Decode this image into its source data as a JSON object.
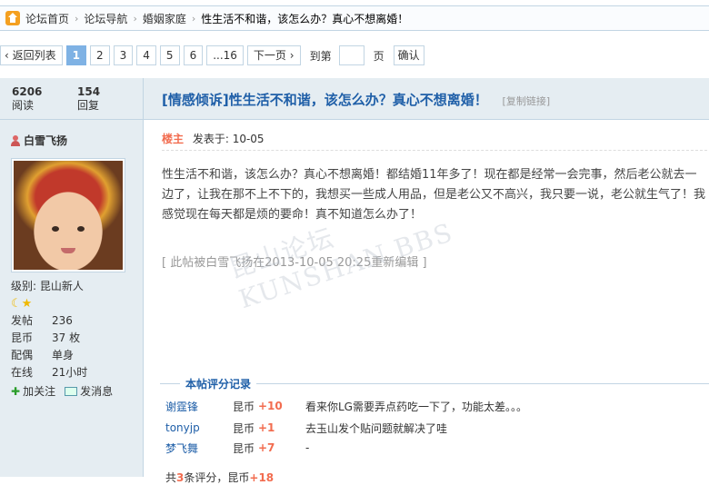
{
  "breadcrumb": {
    "items": [
      "论坛首页",
      "论坛导航",
      "婚姻家庭",
      "性生活不和谐，该怎么办？真心不想离婚！"
    ]
  },
  "pager": {
    "back_label": "返回列表",
    "pages": [
      "1",
      "2",
      "3",
      "4",
      "5",
      "6",
      "...16"
    ],
    "next_label": "下一页",
    "jump_label": "到第",
    "page_unit": "页",
    "confirm_label": "确认"
  },
  "stats": {
    "views": "6206",
    "views_label": "阅读",
    "replies": "154",
    "replies_label": "回复"
  },
  "author": {
    "name": "白雪飞扬",
    "level_label": "级别: 昆山新人",
    "profile": [
      {
        "k": "发帖",
        "v": "236"
      },
      {
        "k": "昆币",
        "v": "37 枚"
      },
      {
        "k": "配偶",
        "v": "单身"
      },
      {
        "k": "在线",
        "v": "21小时"
      }
    ],
    "follow_label": "加关注",
    "message_label": "发消息"
  },
  "post": {
    "title": "[情感倾诉]性生活不和谐，该怎么办？真心不想离婚！",
    "copy_link": "[复制链接]",
    "owner_badge": "楼主",
    "posted_at": "发表于: 10-05",
    "body": "性生活不和谐，该怎么办？真心不想离婚！都结婚11年多了！现在都是经常一会完事，然后老公就去一边了，让我在那不上不下的，我想买一些成人用品，但是老公又不高兴，我只要一说，老公就生气了！我感觉现在每天都是烦的要命！真不知道怎么办了！",
    "edited": "[ 此帖被白雪飞扬在2013-10-05 20:25重新编辑 ]",
    "watermark": "昆山论坛 KUNSHAN.BBS"
  },
  "rating": {
    "title": "本帖评分记录",
    "rows": [
      {
        "name": "谢霆锋",
        "currency": "昆币",
        "value": "+10",
        "reason": "看来你LG需要弄点药吃一下了，功能太差。。。"
      },
      {
        "name": "tonyjp",
        "currency": "昆币",
        "value": "+1",
        "reason": "去玉山发个贴问题就解决了哇"
      },
      {
        "name": "梦飞舞",
        "currency": "昆币",
        "value": "+7",
        "reason": "-"
      }
    ],
    "total_prefix": "共",
    "total_count": "3",
    "total_mid": "条评分，昆币",
    "total_value": "+18"
  }
}
